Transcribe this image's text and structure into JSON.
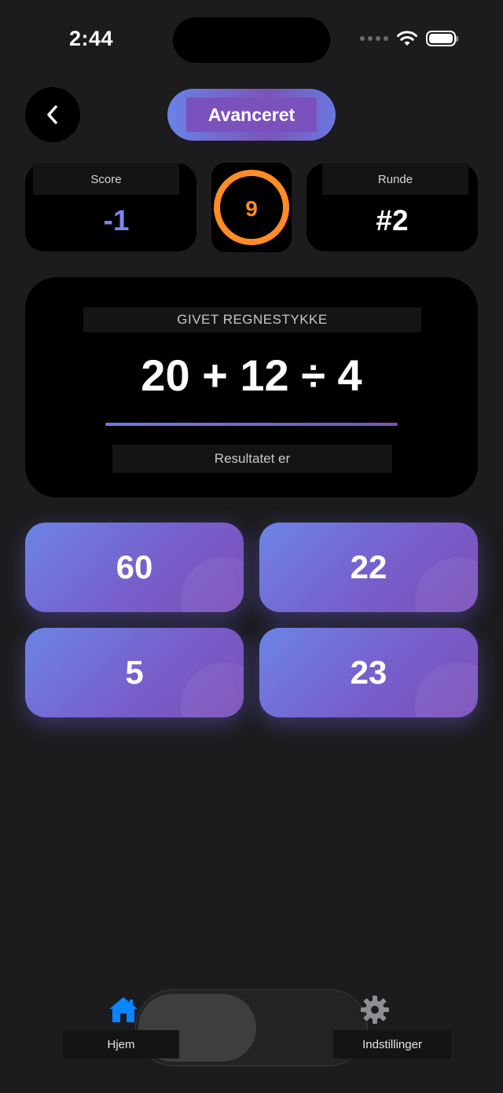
{
  "status_bar": {
    "time": "2:44"
  },
  "header": {
    "back_icon": "chevron-left-icon",
    "level_label": "Avanceret"
  },
  "stats": {
    "score_label": "Score",
    "score_value": "-1",
    "round_label": "Runde",
    "round_value": "#2",
    "timer_value": "9",
    "timer_color": "#ff8c26",
    "score_color": "#7b86e8"
  },
  "question": {
    "label": "GIVET REGNESTYKKE",
    "expression": "20 + 12 ÷ 4",
    "hint": "Resultatet er"
  },
  "answers": [
    {
      "value": "60"
    },
    {
      "value": "22"
    },
    {
      "value": "5"
    },
    {
      "value": "23"
    }
  ],
  "tabbar": {
    "tabs": [
      {
        "label": "Hjem",
        "icon": "home-icon",
        "selected": true
      },
      {
        "label": "Indstillinger",
        "icon": "gear-icon",
        "selected": false
      }
    ],
    "accent_color": "#0a84ff"
  }
}
